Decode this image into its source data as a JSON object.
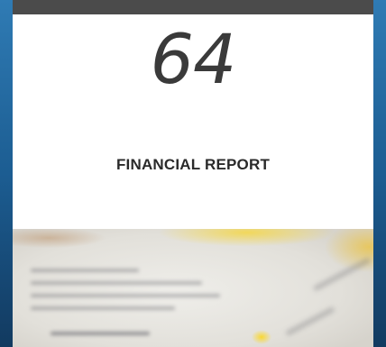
{
  "card": {
    "number": "64",
    "title": "FINANCIAL REPORT"
  },
  "colors": {
    "background": "#1a5688",
    "topbar": "#4b4b4b",
    "card": "#ffffff",
    "text": "#2a2a2a"
  },
  "photo": {
    "description_icon": "blurred-document-photo"
  }
}
